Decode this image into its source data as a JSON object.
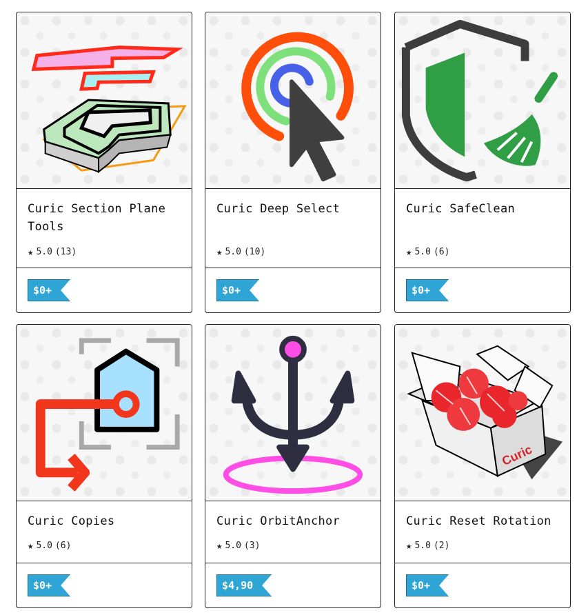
{
  "products": [
    {
      "title": "Curic Section Plane Tools",
      "rating": "5.0",
      "count": "(13)",
      "price": "$0+",
      "icon": "section-plane-icon"
    },
    {
      "title": "Curic Deep Select",
      "rating": "5.0",
      "count": "(10)",
      "price": "$0+",
      "icon": "deep-select-icon"
    },
    {
      "title": "Curic SafeClean",
      "rating": "5.0",
      "count": "(6)",
      "price": "$0+",
      "icon": "safeclean-icon"
    },
    {
      "title": "Curic Copies",
      "rating": "5.0",
      "count": "(6)",
      "price": "$0+",
      "icon": "copies-icon"
    },
    {
      "title": "Curic OrbitAnchor",
      "rating": "5.0",
      "count": "(3)",
      "price": "$4,90",
      "icon": "orbit-anchor-icon"
    },
    {
      "title": "Curic Reset Rotation",
      "rating": "5.0",
      "count": "(2)",
      "price": "$0+",
      "icon": "reset-rotation-icon"
    }
  ],
  "colors": {
    "price_tag": "#2fa5d6",
    "border": "#222222"
  }
}
